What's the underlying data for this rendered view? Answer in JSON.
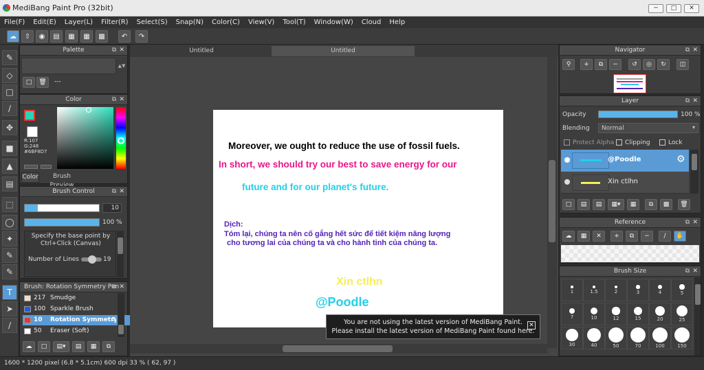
{
  "window": {
    "title": "MediBang Paint Pro (32bit)"
  },
  "menu": [
    "File(F)",
    "Edit(E)",
    "Layer(L)",
    "Filter(R)",
    "Select(S)",
    "Snap(N)",
    "Color(C)",
    "View(V)",
    "Tool(T)",
    "Window(W)",
    "Cloud",
    "Help"
  ],
  "tabs": [
    "Untitled",
    "Untitled"
  ],
  "palette": {
    "title": "Palette",
    "selector_text": "---"
  },
  "color": {
    "title": "Color",
    "r": "R:107",
    "g": "G:248",
    "hex": "#6BF8D7",
    "tab_color": "Color",
    "tab_preview": "Brush Preview",
    "primary": "#2fd1b3",
    "secondary": "#ffffff"
  },
  "brush_control": {
    "title": "Brush Control",
    "size": "10",
    "opacity": "100 %",
    "hint": "Specify the base point by Ctrl+Click (Canvas)",
    "lines_label": "Number of Lines",
    "lines_value": "19"
  },
  "brush_list": {
    "title": "Brush: Rotation Symmetry Pen",
    "items": [
      {
        "size": "217",
        "name": "Smudge",
        "color": "#f3dcc6"
      },
      {
        "size": "100",
        "name": "Sparkle Brush",
        "color": "#2a5bd6"
      },
      {
        "size": "10",
        "name": "Rotation Symmetry",
        "color": "#e23838"
      },
      {
        "size": "50",
        "name": "Eraser (Soft)",
        "color": "#ffffff"
      }
    ]
  },
  "canvas_text": {
    "line1": "Moreover, we ought to reduce the use of fossil fuels.",
    "line2": "In short, we should try our best to save energy for our",
    "line3": "future  and for our planet's future.",
    "dich_label": "Dịch:",
    "viet1": "Tóm lại, chúng ta nên cố gắng hết sức để tiết kiệm năng lượng",
    "viet2": "cho tương lai của chúng ta và cho hành tinh của chúng ta.",
    "xin": "Xin ctlhn",
    "poodle": "@Poodle"
  },
  "notice": {
    "line1": "You are not using the latest version of MediBang Paint.",
    "line2": "Please install the latest version of MediBang Paint found here."
  },
  "navigator": {
    "title": "Navigator"
  },
  "layer": {
    "title": "Layer",
    "opacity_label": "Opacity",
    "opacity_value": "100 %",
    "blending_label": "Blending",
    "blending_value": "Normal",
    "protect_alpha": "Protect Alpha",
    "clipping": "Clipping",
    "lock": "Lock",
    "items": [
      {
        "name": "@Poodle",
        "selected": true
      },
      {
        "name": "Xin ctlhn",
        "selected": false
      }
    ]
  },
  "reference": {
    "title": "Reference"
  },
  "brush_size": {
    "title": "Brush Size",
    "sizes": [
      "1",
      "1.5",
      "2",
      "3",
      "4",
      "5",
      "7",
      "10",
      "12",
      "15",
      "20",
      "25",
      "30",
      "40",
      "50",
      "70",
      "100",
      "150"
    ]
  },
  "status": "1600 * 1200 pixel  (6.8 * 5.1cm)  600 dpi  33 %  ( 62, 97 )"
}
